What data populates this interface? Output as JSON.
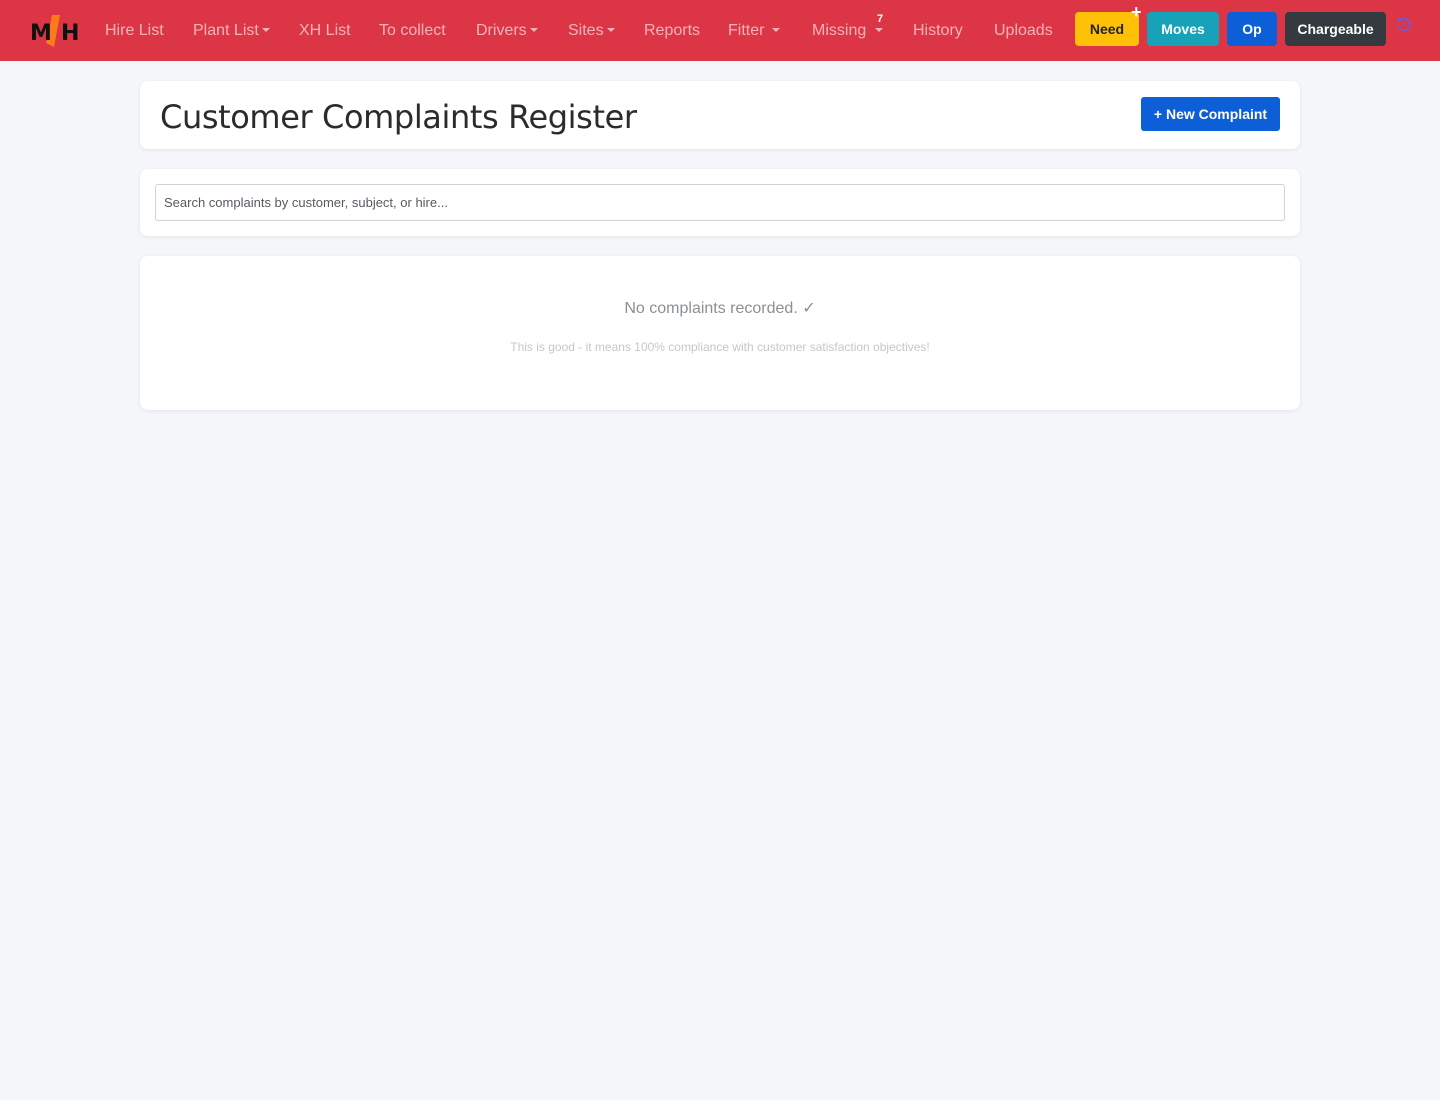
{
  "navbar": {
    "logo_text": "MJH",
    "items": [
      {
        "label": "Hire List",
        "dropdown": false
      },
      {
        "label": "Plant List",
        "dropdown": true
      },
      {
        "label": "XH List",
        "dropdown": false
      },
      {
        "label": "To collect",
        "dropdown": false
      },
      {
        "label": "Drivers",
        "dropdown": true
      },
      {
        "label": "Sites",
        "dropdown": true
      },
      {
        "label": "Reports",
        "dropdown": false
      },
      {
        "label": "Fitter",
        "dropdown": true
      },
      {
        "label": "Missing",
        "dropdown": true,
        "badge": "7"
      },
      {
        "label": "History",
        "dropdown": false
      },
      {
        "label": "Uploads",
        "dropdown": false
      }
    ],
    "buttons": {
      "need": "Need",
      "need_icon": "plus-icon",
      "moves": "Moves",
      "op": "Op",
      "chargeable": "Chargeable"
    },
    "trailing_icon": "history-icon",
    "colors": {
      "navbar_bg": "#dc3545",
      "need_bg": "#ffc107",
      "moves_bg": "#17a2b8",
      "op_bg": "#0d5fd8",
      "chargeable_bg": "#343a40"
    }
  },
  "header": {
    "title": "Customer Complaints Register",
    "new_button_label": "+ New Complaint"
  },
  "search": {
    "value": "",
    "placeholder": "Search complaints by customer, subject, or hire..."
  },
  "empty_state": {
    "title": "No complaints recorded. ✓",
    "subtitle": "This is good - it means 100% compliance with customer satisfaction objectives!"
  }
}
